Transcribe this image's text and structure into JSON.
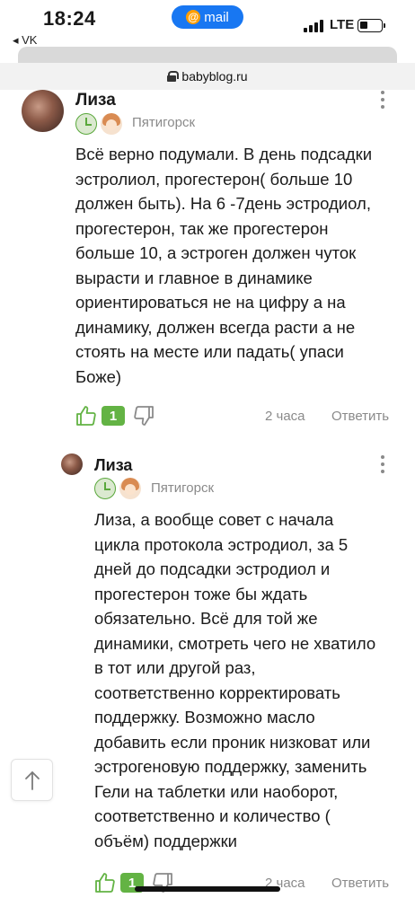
{
  "status_bar": {
    "time": "18:24",
    "back_app": "◂ VK",
    "center_app": "mail",
    "network": "LTE"
  },
  "browser": {
    "url": "babyblog.ru"
  },
  "comments": [
    {
      "author": "Лиза",
      "city": "Пятигорск",
      "lines": [
        "Всё верно подумали. В день подсадки",
        "эстролиол, прогестерон( больше 10",
        "должен быть). На 6 -7день эстродиол,",
        "прогестерон, так же прогестерон",
        "больше 10, а эстроген должен чуток",
        "вырасти и главное в динамике",
        "ориентироваться не на цифру а на",
        "динамику, должен всегда расти а не",
        "стоять на месте или падать( упаси",
        "Боже)"
      ],
      "likes": "1",
      "time_ago": "2 часа",
      "reply_label": "Ответить"
    },
    {
      "author": "Лиза",
      "city": "Пятигорск",
      "lines": [
        "Лиза, а вообще совет с начала",
        "цикла протокола эстродиол, за 5",
        "дней до подсадки эстродиол и",
        "прогестерон тоже бы ждать",
        "обязательно. Всё для той же",
        "динамики, смотреть чего не хватило",
        "в тот или другой раз,",
        "соответственно корректировать",
        "поддержку. Возможно масло",
        "добавить если проник низковат или",
        "эстрогеновую поддержку, заменить",
        "Гели на таблетки или наоборот,",
        "соответственно и количество (",
        "объём) поддержки"
      ],
      "likes": "1",
      "time_ago": "2 часа",
      "reply_label": "Ответить"
    }
  ],
  "colors": {
    "accent_green": "#63b344",
    "muted_text": "#8a8a8a",
    "mail_blue": "#1877f2"
  },
  "icons": [
    "thumb-up-icon",
    "thumb-down-icon",
    "clock-badge-icon",
    "girl-badge-icon",
    "more-vertical-icon",
    "arrow-up-icon",
    "lock-icon"
  ]
}
